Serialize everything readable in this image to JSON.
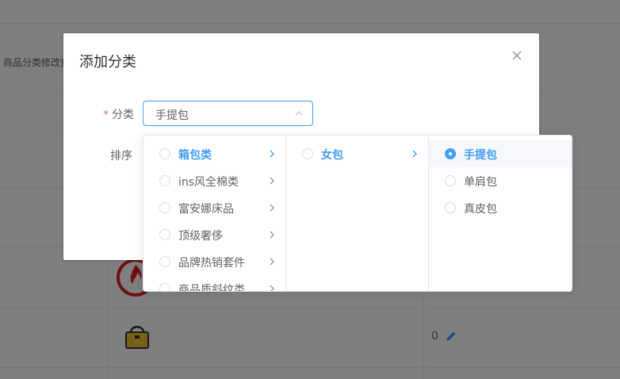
{
  "background": {
    "header_cell": "商品分类修改查",
    "row_value": "0"
  },
  "dialog": {
    "title": "添加分类",
    "form": {
      "category_label": "分类",
      "required_mark": "*",
      "category_value": "手提包",
      "sort_label": "排序"
    }
  },
  "cascader": {
    "panel1": [
      {
        "label": "箱包类",
        "active": true
      },
      {
        "label": "ins风全棉类"
      },
      {
        "label": "富安娜床品"
      },
      {
        "label": "顶级奢侈"
      },
      {
        "label": "品牌热销套件"
      },
      {
        "label": "商品质斜纹类"
      }
    ],
    "panel2": [
      {
        "label": "女包",
        "active": true
      }
    ],
    "panel3": [
      {
        "label": "手提包",
        "active": true,
        "checked": true
      },
      {
        "label": "单肩包"
      },
      {
        "label": "真皮包"
      }
    ]
  },
  "colors": {
    "primary": "#409eff",
    "required": "#f56c6c",
    "text": "#606266"
  }
}
